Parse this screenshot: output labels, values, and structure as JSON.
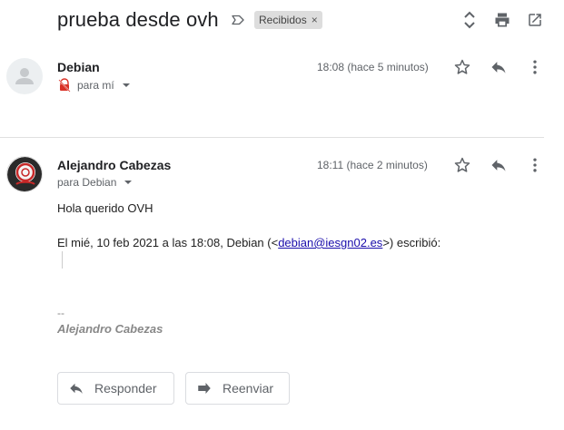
{
  "thread": {
    "subject": "prueba desde ovh",
    "label_chip": "Recibidos",
    "label_chip_close": "×"
  },
  "messages": [
    {
      "sender": "Debian",
      "time": "18:08 (hace 5 minutos)",
      "to": "para mí"
    },
    {
      "sender": "Alejandro Cabezas",
      "time": "18:11 (hace 2 minutos)",
      "to": "para Debian",
      "body_greeting": "Hola querido OVH",
      "quote_prefix": "El mié, 10 feb 2021 a las 18:08, Debian (<",
      "quote_email": "debian@iesgn02.es",
      "quote_suffix": ">) escribió:",
      "signature_dash": "--",
      "signature_name": "Alejandro Cabezas"
    }
  ],
  "actions": {
    "reply_label": "Responder",
    "forward_label": "Reenviar"
  }
}
